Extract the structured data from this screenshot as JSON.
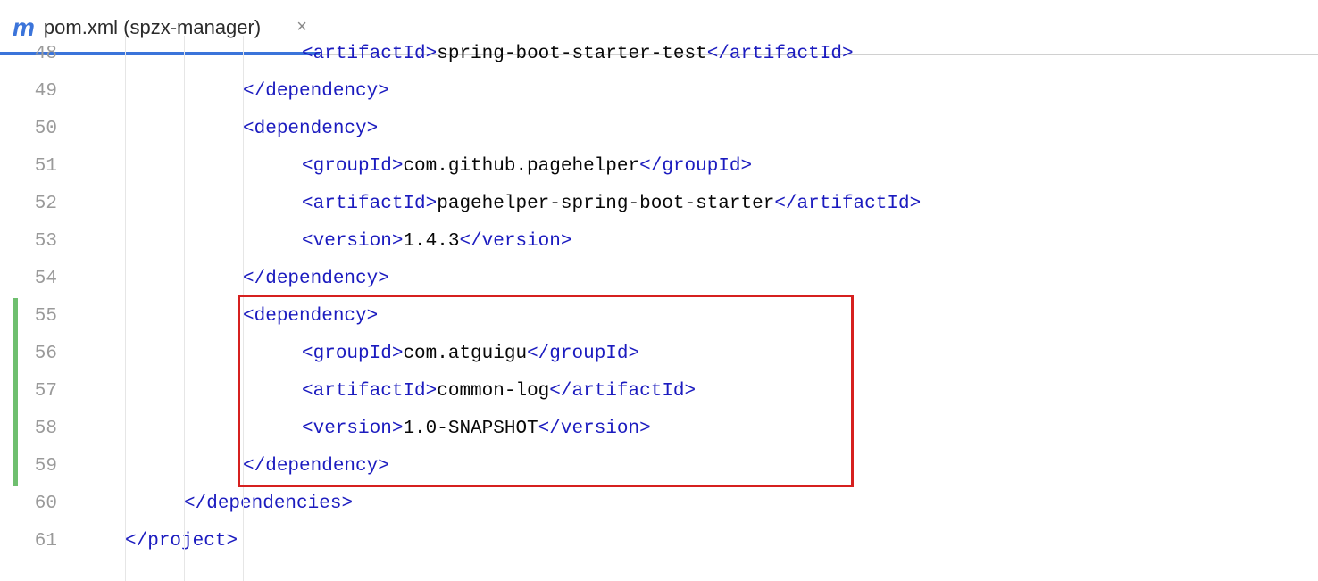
{
  "tab": {
    "icon_letter": "m",
    "title": "pom.xml (spzx-manager)",
    "close": "×"
  },
  "gutter": {
    "start": 48,
    "end": 61
  },
  "code": {
    "lines": [
      {
        "indent": 3,
        "open": "artifactId",
        "text": "spring-boot-starter-test",
        "close": "artifactId",
        "cutTop": true
      },
      {
        "indent": 2,
        "closeOnly": "dependency"
      },
      {
        "indent": 2,
        "open": "dependency"
      },
      {
        "indent": 3,
        "open": "groupId",
        "text": "com.github.pagehelper",
        "close": "groupId"
      },
      {
        "indent": 3,
        "open": "artifactId",
        "text": "pagehelper-spring-boot-starter",
        "close": "artifactId"
      },
      {
        "indent": 3,
        "open": "version",
        "text": "1.4.3",
        "close": "version"
      },
      {
        "indent": 2,
        "closeOnly": "dependency"
      },
      {
        "indent": 2,
        "open": "dependency"
      },
      {
        "indent": 3,
        "open": "groupId",
        "text": "com.atguigu",
        "close": "groupId"
      },
      {
        "indent": 3,
        "open": "artifactId",
        "text": "common-log",
        "close": "artifactId"
      },
      {
        "indent": 3,
        "open": "version",
        "text": "1.0-SNAPSHOT",
        "close": "version"
      },
      {
        "indent": 2,
        "closeOnly": "dependency"
      },
      {
        "indent": 1,
        "closeOnly": "dependencies"
      },
      {
        "indent": 0,
        "closeOnly": "project"
      }
    ]
  },
  "highlight": {
    "fromLine": 55,
    "toLine": 59
  },
  "vmark": {
    "fromLine": 55,
    "toLine": 59
  },
  "layout": {
    "codeLeft": 82,
    "lineHeight": 42,
    "firstLineTopOffset": -22,
    "indentUnitPx": 66,
    "baseIndentPx": 58
  }
}
